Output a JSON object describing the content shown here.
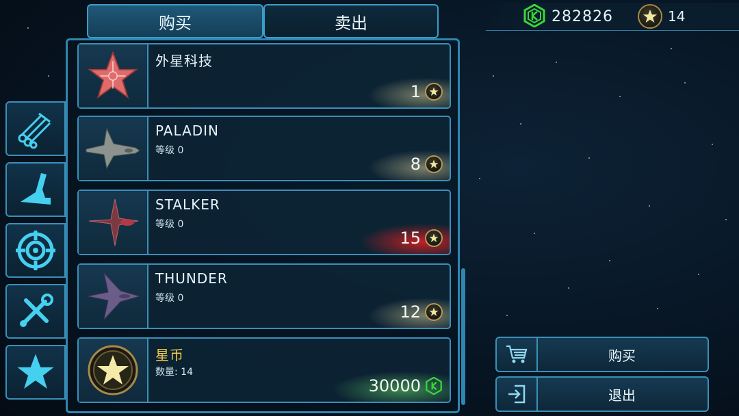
{
  "currency": {
    "credits": "282826",
    "star_coins": "14",
    "credits_icon": "credit-hex-icon",
    "star_icon": "star-coin-icon"
  },
  "tabs": {
    "buy": "购买",
    "sell": "卖出",
    "active": "buy"
  },
  "side_tabs": [
    {
      "name": "materials",
      "icon": "pipes-icon"
    },
    {
      "name": "ship-hulls",
      "icon": "hull-icon"
    },
    {
      "name": "weapons",
      "icon": "target-icon"
    },
    {
      "name": "tools",
      "icon": "tools-icon"
    },
    {
      "name": "special",
      "icon": "star-icon"
    }
  ],
  "items": [
    {
      "name": "外星科技",
      "sub": "",
      "price": "1",
      "currency": "star",
      "highlight": "gold",
      "icon": "alien-tech-icon"
    },
    {
      "name": "PALADIN",
      "sub": "等级 0",
      "price": "8",
      "currency": "star",
      "highlight": "gold",
      "icon": "paladin-ship-icon"
    },
    {
      "name": "STALKER",
      "sub": "等级 0",
      "price": "15",
      "currency": "star",
      "highlight": "red",
      "icon": "stalker-ship-icon"
    },
    {
      "name": "THUNDER",
      "sub": "等级 0",
      "price": "12",
      "currency": "star",
      "highlight": "gold",
      "icon": "thunder-ship-icon"
    },
    {
      "name": "星币",
      "sub": "数量: 14",
      "price": "30000",
      "currency": "credits",
      "highlight": "green",
      "icon": "star-coin-icon"
    }
  ],
  "actions": {
    "buy": "购买",
    "exit": "退出"
  },
  "colors": {
    "accent": "#3b8fb8",
    "gold": "#f2c94c",
    "credit_green": "#39d63a",
    "alert_red": "#ff2020"
  }
}
